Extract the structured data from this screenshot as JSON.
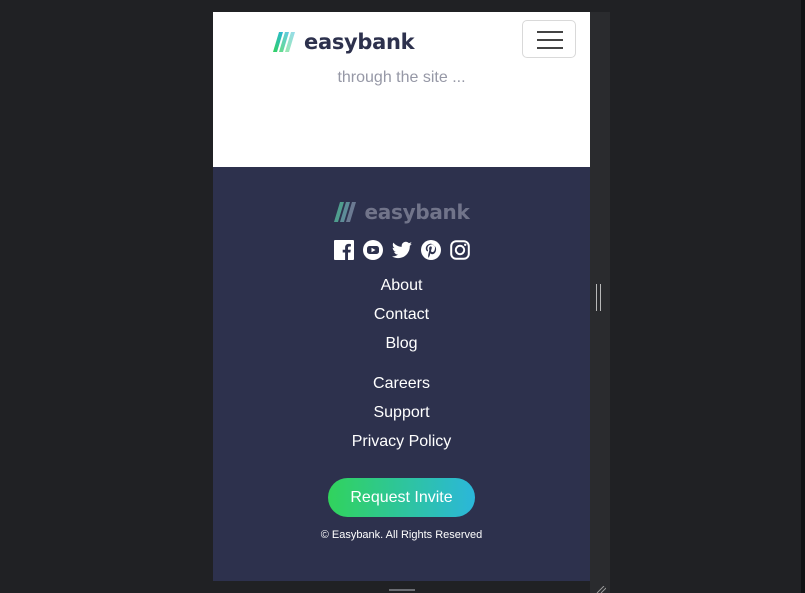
{
  "header": {
    "brand": "easybank"
  },
  "hero": {
    "teaser": "through the site ..."
  },
  "footer": {
    "brand": "easybank",
    "social": [
      "facebook-icon",
      "youtube-icon",
      "twitter-icon",
      "pinterest-icon",
      "instagram-icon"
    ],
    "links_col1": [
      "About",
      "Contact",
      "Blog"
    ],
    "links_col2": [
      "Careers",
      "Support",
      "Privacy Policy"
    ],
    "cta": "Request Invite",
    "copyright": "© Easybank. All Rights Reserved"
  },
  "colors": {
    "navy": "#2d314d",
    "green": "#31d35c",
    "cyan": "#2bb7da",
    "grayText": "#9698a6"
  }
}
